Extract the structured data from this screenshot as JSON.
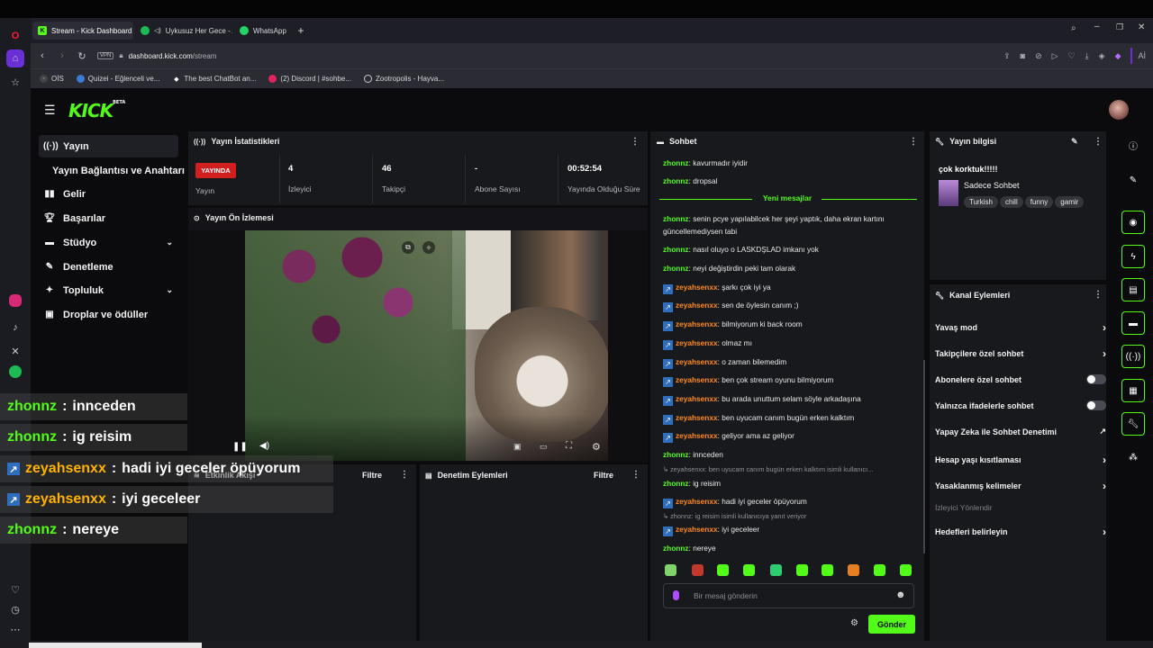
{
  "browser": {
    "tabs": [
      {
        "label": "Stream - Kick Dashboard",
        "active": true
      },
      {
        "label": "Uykusuz Her Gece - A",
        "active": false
      },
      {
        "label": "WhatsApp",
        "active": false
      }
    ],
    "url_domain": "dashboard.kick.com",
    "url_path": "/stream",
    "vpn_label": "VPN",
    "ai_label": "Aİ",
    "bookmarks": [
      "OİS",
      "Quizei - Eğlenceli ve...",
      "The best ChatBot an...",
      "(2) Discord | #sohbe...",
      "Zootropolis - Hayva..."
    ]
  },
  "nav": {
    "items": [
      {
        "label": "Yayın",
        "icon": "broadcast-icon",
        "active": true
      },
      {
        "label": "Yayın Bağlantısı ve Anahtarı",
        "icon": "",
        "active": false
      },
      {
        "label": "Gelir",
        "icon": "revenue-icon",
        "active": false
      },
      {
        "label": "Başarılar",
        "icon": "trophy-icon",
        "active": false
      },
      {
        "label": "Stüdyo",
        "icon": "studio-icon",
        "active": false,
        "chevron": true
      },
      {
        "label": "Denetleme",
        "icon": "moderation-icon",
        "active": false
      },
      {
        "label": "Topluluk",
        "icon": "community-icon",
        "active": false,
        "chevron": true
      },
      {
        "label": "Droplar ve ödüller",
        "icon": "gift-icon",
        "active": false
      }
    ]
  },
  "stats": {
    "title": "Yayın İstatistikleri",
    "live_badge": "YAYINDA",
    "broadcast_label": "Yayın",
    "viewers_value": "4",
    "viewers_label": "İzleyici",
    "followers_value": "46",
    "followers_label": "Takipçi",
    "subs_value": "-",
    "subs_label": "Abone Sayısı",
    "uptime_value": "00:52:54",
    "uptime_label": "Yayında Olduğu Süre"
  },
  "preview": {
    "title": "Yayın Ön İzlemesi"
  },
  "activity": {
    "feed_title": "Etkinlik Akışı",
    "feed_filter": "Filtre",
    "mod_title": "Denetim Eylemleri",
    "mod_filter": "Filtre"
  },
  "chat": {
    "title": "Sohbet",
    "new_messages": "Yeni mesajlar",
    "input_placeholder": "Bir mesaj gönderin",
    "send_label": "Gönder",
    "messages": [
      {
        "user": "zhonnz",
        "text": "kavurmadır iyidir",
        "type": "green"
      },
      {
        "user": "zhonnz",
        "text": "dropsal",
        "type": "green"
      },
      {
        "user": "zhonnz",
        "text": "senin pcye yapılabilcek her şeyi yaptık, daha ekran kartını",
        "text2": "güncellemediysen tabi",
        "type": "green"
      },
      {
        "user": "zhonnz",
        "text": "nasıl oluyo o LASKDŞLAD imkanı yok",
        "type": "green"
      },
      {
        "user": "zhonnz",
        "text": "neyi değiştirdin peki tam olarak",
        "type": "green"
      },
      {
        "user": "zeyahsenxx",
        "text": "şarkı çok iyi ya",
        "type": "kick"
      },
      {
        "user": "zeyahsenxx",
        "text": "sen de öylesin canım ;)",
        "type": "kick"
      },
      {
        "user": "zeyahsenxx",
        "text": "bilmiyorum ki back room",
        "type": "kick"
      },
      {
        "user": "zeyahsenxx",
        "text": "olmaz mı",
        "type": "kick"
      },
      {
        "user": "zeyahsenxx",
        "text": "o zaman bilemedim",
        "type": "kick"
      },
      {
        "user": "zeyahsenxx",
        "text": "ben çok stream oyunu bilmiyorum",
        "type": "kick"
      },
      {
        "user": "zeyahsenxx",
        "text": "bu arada unuttum selam söyle arkadaşına",
        "type": "kick"
      },
      {
        "user": "zeyahsenxx",
        "text": "ben uyucam canım bugün erken kalktım",
        "type": "kick"
      },
      {
        "user": "zeyahsenxx",
        "text": "geliyor ama az geliyor",
        "type": "kick"
      },
      {
        "user": "zhonnz",
        "text": "innceden",
        "type": "green"
      },
      {
        "reply": "zeyahsenxx: ben uyucam canım bugün erken kalktım isimli kullanıcı..."
      },
      {
        "user": "zhonnz",
        "text": "ig reisim",
        "type": "green"
      },
      {
        "user": "zeyahsenxx",
        "text": "hadi iyi geceler öpüyorum",
        "type": "kick"
      },
      {
        "reply": "zhonnz: ig reisim isimli kullanıcıya yanıt veriyor"
      },
      {
        "user": "zeyahsenxx",
        "text": "iyi geceleer",
        "type": "kick"
      },
      {
        "user": "zhonnz",
        "text": "nereye",
        "type": "green"
      }
    ]
  },
  "overlay_chat": [
    {
      "user": "zhonnz",
      "text": "innceden",
      "type": "green"
    },
    {
      "user": "zhonnz",
      "text": "ig reisim",
      "type": "green"
    },
    {
      "user": "zeyahsenxx",
      "text": "hadi iyi geceler öpüyorum",
      "type": "kick"
    },
    {
      "user": "zeyahsenxx",
      "text": "iyi geceleer",
      "type": "kick"
    },
    {
      "user": "zhonnz",
      "text": "nereye",
      "type": "green"
    }
  ],
  "stream_info": {
    "title": "Yayın bilgisi",
    "stream_title": "çok korktuk!!!!!",
    "category": "Sadece Sohbet",
    "tags": [
      "Turkish",
      "chill",
      "funny",
      "gamir"
    ]
  },
  "channel_actions": {
    "title": "Kanal Eylemleri",
    "items": [
      {
        "label": "Yavaş mod",
        "control": "chevron"
      },
      {
        "label": "Takipçilere özel sohbet",
        "control": "chevron"
      },
      {
        "label": "Abonelere özel sohbet",
        "control": "toggle"
      },
      {
        "label": "Yalnızca ifadelerle sohbet",
        "control": "toggle"
      },
      {
        "label": "Yapay Zeka ile Sohbet Denetimi",
        "control": "external"
      },
      {
        "label": "Hesap yaşı kısıtlaması",
        "control": "chevron"
      },
      {
        "label": "Yasaklanmış kelimeler",
        "control": "chevron"
      }
    ],
    "section_label": "İzleyici Yönlendir",
    "goals_label": "Hedefleri belirleyin"
  },
  "colors": {
    "kick_green": "#53fc18",
    "live_red": "#d11e1e",
    "username_orange": "#ff8a1f",
    "panel_bg": "#18191d",
    "page_bg": "#0b0b0d"
  }
}
